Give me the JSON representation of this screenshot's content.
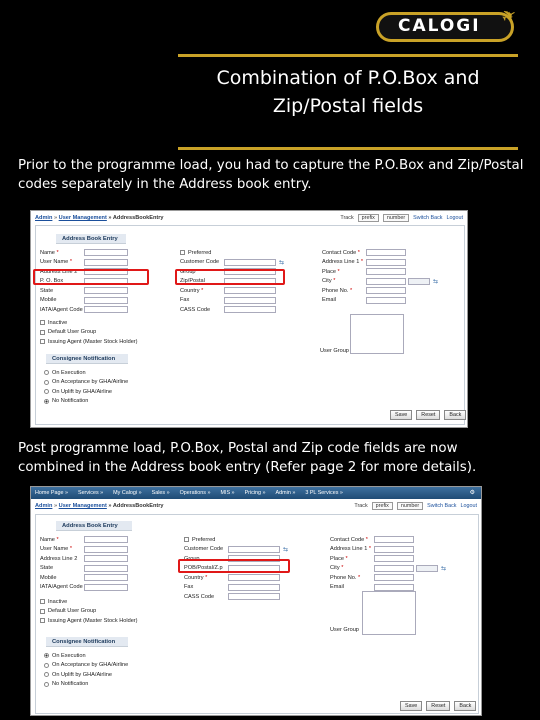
{
  "logo": {
    "text": "CALOGI"
  },
  "title": {
    "line1": "Combination of P.O.Box and",
    "line2": "Zip/Postal fields"
  },
  "paragraph1": "Prior to the programme load, you had to capture the P.O.Box and Zip/Postal codes separately in the Address book entry.",
  "paragraph2": "Post programme load, P.O.Box, Postal and Zip code fields are now combined in the Address book entry (Refer page 2 for more details).",
  "shot1": {
    "breadcrumb": {
      "home": "Admin",
      "sep": "»",
      "section": "User Management",
      "page": "» AddressBookEntry"
    },
    "top": {
      "track": "Track",
      "prefix": "prefix",
      "number": "number",
      "switch_back": "Switch Back",
      "logout": "Logout"
    },
    "section_title": "Address Book Entry",
    "left": [
      "Name",
      "User Name",
      "Address Line 2",
      "P. O. Box",
      "State",
      "Mobile",
      "IATA/Agent Code"
    ],
    "mid": [
      "Preferred",
      "Customer Code",
      "Group",
      "Zip/Postal",
      "Country",
      "Fax",
      "CASS Code"
    ],
    "right": [
      "Contact Code",
      "Address Line 1",
      "Place",
      "City",
      "Phone No.",
      "Email"
    ],
    "checks": [
      "Inactive",
      "Default User Group",
      "Issuing Agent (Master Stock Holder)"
    ],
    "notes_label": "User Group",
    "notify_title": "Consignee Notification",
    "notify": [
      "On Execution",
      "On Acceptance by GHA/Airline",
      "On Uplift by GHA/Airline",
      "No Notification"
    ],
    "buttons": [
      "Save",
      "Reset",
      "Back"
    ]
  },
  "shot2": {
    "tabs": [
      "Home Page »",
      "Services »",
      "My Calogi »",
      "Sales »",
      "Operations »",
      "MIS »",
      "Pricing »",
      "Admin »",
      "3 PL Services »"
    ],
    "breadcrumb": {
      "home": "Admin",
      "sep": "»",
      "section": "User Management",
      "page": "» AddressBookEntry"
    },
    "top": {
      "track": "Track",
      "prefix": "prefix",
      "number": "number",
      "switch_back": "Switch Back",
      "logout": "Logout"
    },
    "section_title": "Address Book Entry",
    "left": [
      "Name",
      "User Name",
      "Address Line 2",
      "State",
      "Mobile",
      "IATA/Agent Code"
    ],
    "mid": [
      "Preferred",
      "Customer Code",
      "Group",
      "POB/Postal/Z.p",
      "Country",
      "Fax",
      "CASS Code"
    ],
    "right": [
      "Contact Code",
      "Address Line 1",
      "Place",
      "City",
      "Phone No.",
      "Email"
    ],
    "checks": [
      "Inactive",
      "Default User Group",
      "Issuing Agent (Master Stock Holder)"
    ],
    "notes_label": "User Group",
    "notify_title": "Consignee Notification",
    "notify": [
      "On Execution",
      "On Acceptance by GHA/Airline",
      "On Uplift by GHA/Airline",
      "No Notification"
    ],
    "buttons": [
      "Save",
      "Reset",
      "Back"
    ]
  }
}
